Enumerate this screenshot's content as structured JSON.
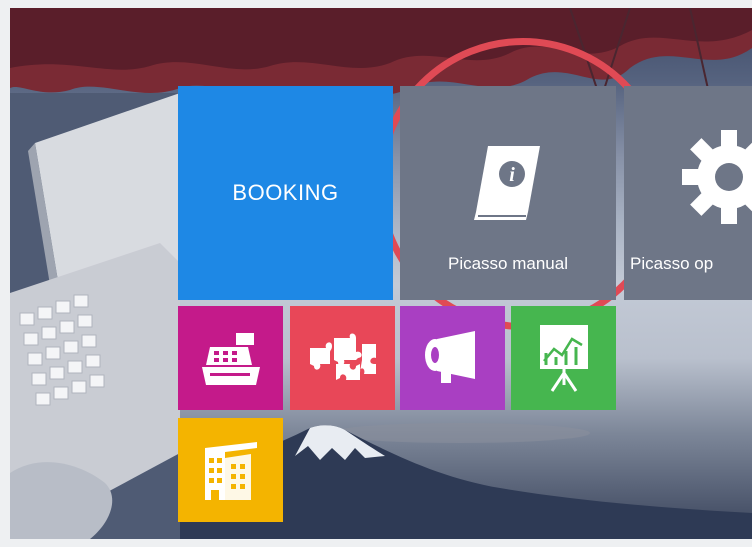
{
  "tiles": {
    "booking": {
      "label": "BOOKING"
    },
    "manual": {
      "label": "Picasso manual"
    },
    "options": {
      "label": "Picasso op"
    }
  },
  "icons": {
    "manual": "info-book-icon",
    "options": "gear-icon",
    "cash": "cash-register-icon",
    "puzzle": "puzzle-icon",
    "mega": "megaphone-icon",
    "chart": "chart-board-icon",
    "hotel": "hotel-icon"
  },
  "colors": {
    "booking": "#1e88e5",
    "manual": "#6e7687",
    "cash": "#c41a8a",
    "puzzle": "#e84758",
    "mega": "#a93fc2",
    "chart": "#46b64f",
    "hotel": "#f4b400",
    "highlight": "#e04a55"
  }
}
